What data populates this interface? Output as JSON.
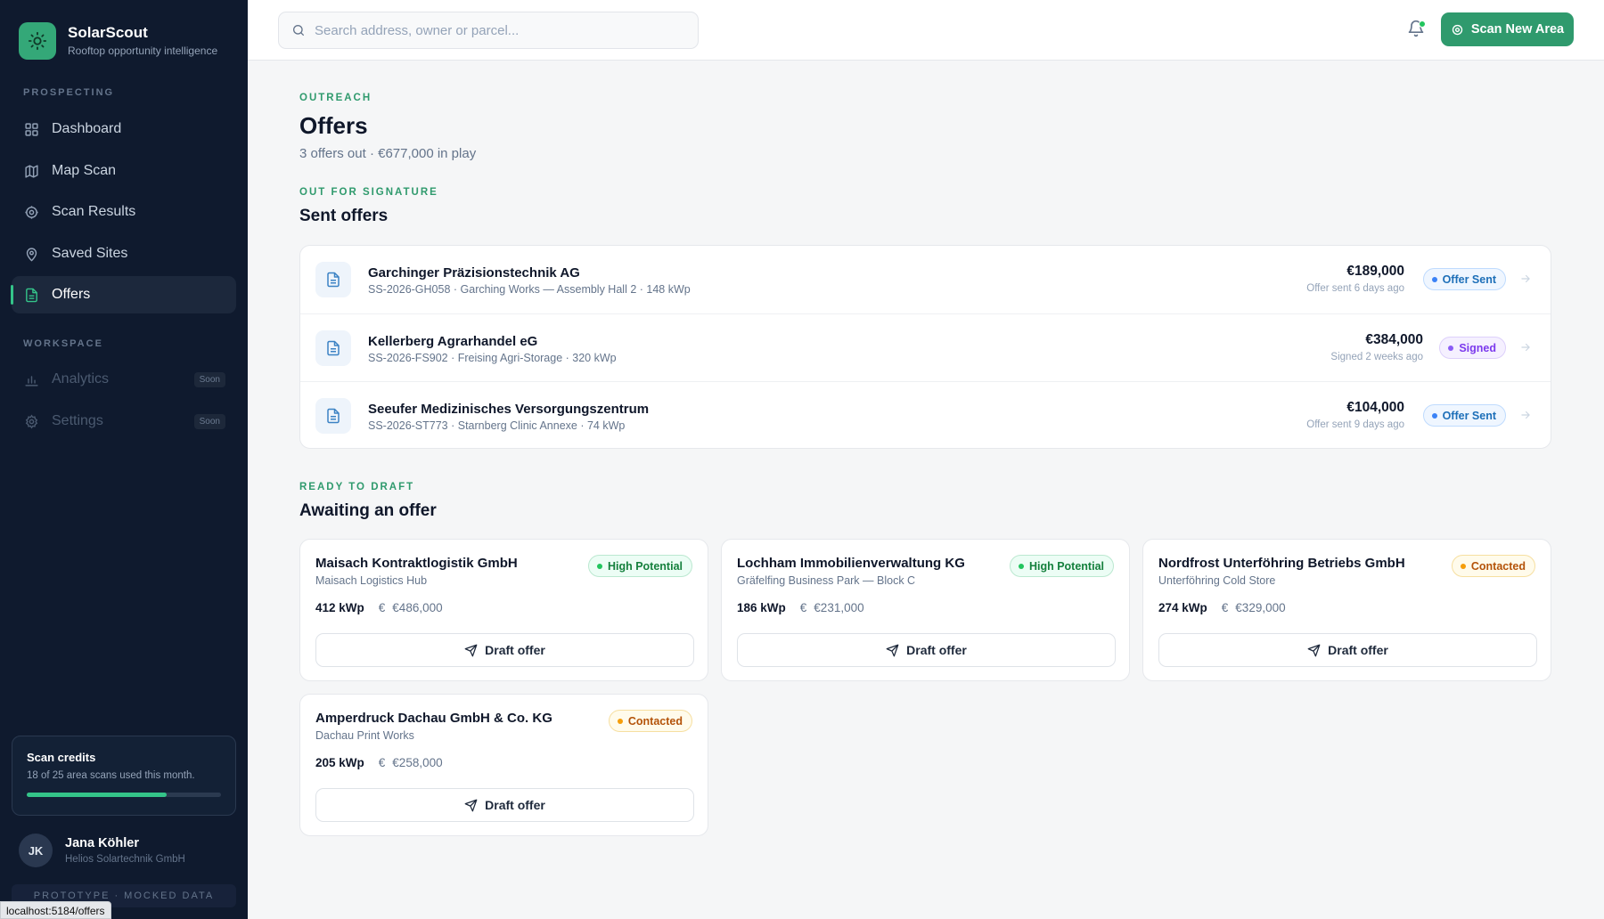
{
  "brand": {
    "name": "SolarScout",
    "tagline": "Rooftop opportunity intelligence"
  },
  "nav": {
    "section_prospecting": "PROSPECTING",
    "section_workspace": "WORKSPACE",
    "items": [
      {
        "label": "Dashboard",
        "icon": "grid-icon"
      },
      {
        "label": "Map Scan",
        "icon": "map-icon"
      },
      {
        "label": "Scan Results",
        "icon": "target-icon"
      },
      {
        "label": "Saved Sites",
        "icon": "pin-icon"
      },
      {
        "label": "Offers",
        "icon": "document-icon",
        "active": true
      }
    ],
    "workspace_items": [
      {
        "label": "Analytics",
        "icon": "bar-chart-icon",
        "badge": "Soon"
      },
      {
        "label": "Settings",
        "icon": "gear-icon",
        "badge": "Soon"
      }
    ]
  },
  "credits": {
    "title": "Scan credits",
    "subtitle": "18 of 25 area scans used this month.",
    "used": 18,
    "total": 25
  },
  "user": {
    "initials": "JK",
    "name": "Jana Köhler",
    "org": "Helios Solartechnik GmbH"
  },
  "prototype_note": "PROTOTYPE · MOCKED DATA",
  "status_url": "localhost:5184/offers",
  "topbar": {
    "search_placeholder": "Search address, owner or parcel...",
    "scan_button": "Scan New Area"
  },
  "page": {
    "eyebrow": "OUTREACH",
    "title": "Offers",
    "subtitle": "3 offers out · €677,000 in play"
  },
  "sent": {
    "eyebrow": "OUT FOR SIGNATURE",
    "title": "Sent offers",
    "rows": [
      {
        "company": "Garchinger Präzisionstechnik AG",
        "meta": "SS-2026-GH058 · Garching Works — Assembly Hall 2 · 148 kWp",
        "amount": "€189,000",
        "when": "Offer sent 6 days ago",
        "status": "Offer Sent"
      },
      {
        "company": "Kellerberg Agrarhandel eG",
        "meta": "SS-2026-FS902 · Freising Agri-Storage · 320 kWp",
        "amount": "€384,000",
        "when": "Signed 2 weeks ago",
        "status": "Signed"
      },
      {
        "company": "Seeufer Medizinisches Versorgungszentrum",
        "meta": "SS-2026-ST773 · Starnberg Clinic Annexe · 74 kWp",
        "amount": "€104,000",
        "when": "Offer sent 9 days ago",
        "status": "Offer Sent"
      }
    ]
  },
  "awaiting": {
    "eyebrow": "READY TO DRAFT",
    "title": "Awaiting an offer",
    "cards": [
      {
        "company": "Maisach Kontraktlogistik GmbH",
        "site": "Maisach Logistics Hub",
        "kwp": "412 kWp",
        "euro": "€",
        "value": "€486,000",
        "badge": "High Potential",
        "action": "Draft offer"
      },
      {
        "company": "Lochham Immobilienverwaltung KG",
        "site": "Gräfelfing Business Park — Block C",
        "kwp": "186 kWp",
        "euro": "€",
        "value": "€231,000",
        "badge": "High Potential",
        "action": "Draft offer"
      },
      {
        "company": "Nordfrost Unterföhring Betriebs GmbH",
        "site": "Unterföhring Cold Store",
        "kwp": "274 kWp",
        "euro": "€",
        "value": "€329,000",
        "badge": "Contacted",
        "action": "Draft offer"
      },
      {
        "company": "Amperdruck Dachau GmbH & Co. KG",
        "site": "Dachau Print Works",
        "kwp": "205 kWp",
        "euro": "€",
        "value": "€258,000",
        "badge": "Contacted",
        "action": "Draft offer"
      }
    ]
  },
  "colors": {
    "accent": "#2f9a6d",
    "sidebar": "#0f1a2e",
    "brand_logo": "#34a878"
  }
}
